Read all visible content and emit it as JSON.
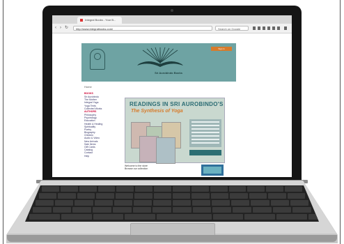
{
  "browser": {
    "tab_title": "Integral Books - Your B...",
    "url": "http://www.integralbooks.com/",
    "search_placeholder": "Search on Google"
  },
  "site": {
    "top_button": "Sign in",
    "tagline": "Sri Aurobindo Books",
    "breadcrumb": "Home",
    "promo_title_1": "READINGS IN SRI AUROBINDO'S",
    "promo_title_2": "The Synthesis of Yoga",
    "sidebar": {
      "heading_1": "BOOKS",
      "items_1": [
        "Sri Aurobindo",
        "The Mother",
        "Integral Yoga",
        "Yoga Texts",
        "Collected Works"
      ],
      "heading_2": "AUTHORS",
      "items_2": [
        "Philosophy",
        "Psychology",
        "Education",
        "Health & Healing",
        "Spirituality",
        "Poetry",
        "Biography",
        "Children",
        "Audio & Video",
        "New Arrivals",
        "Sale Items",
        "Gift Cards",
        "Catalog",
        "Contact",
        "Help"
      ]
    },
    "note_lines": [
      "Welcome to the store",
      "Browse our collection"
    ]
  },
  "colors": {
    "banner": "#6ea3a3",
    "accent": "#d77b2b",
    "promo_title": "#2a6b73",
    "bezel": "#151515"
  }
}
